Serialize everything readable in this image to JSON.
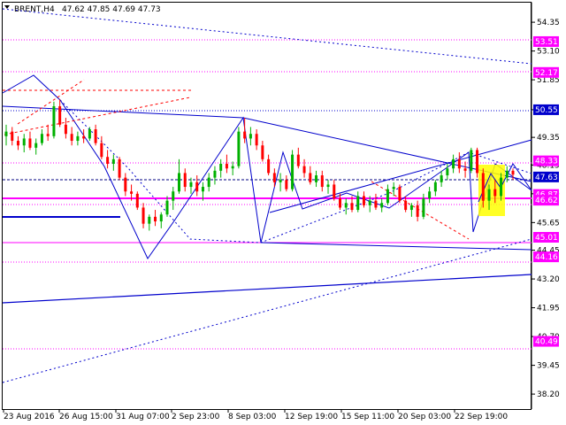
{
  "header": {
    "symbol_timeframe": "BRENT,H4",
    "ohlc": "47.62 47.85 47.69 47.73"
  },
  "chart_data": {
    "type": "candlestick",
    "title": "",
    "xlabel": "",
    "ylabel": "",
    "ylim": [
      37.55,
      55.2
    ],
    "grid": false,
    "y_ticks": [
      54.35,
      53.1,
      51.85,
      50.55,
      49.35,
      48.15,
      46.9,
      45.65,
      44.45,
      43.2,
      41.95,
      40.7,
      39.45,
      38.2
    ],
    "x_ticks": [
      "23 Aug 2016",
      "26 Aug 15:00",
      "31 Aug 07:00",
      "2 Sep 23:00",
      "8 Sep 03:00",
      "12 Sep 19:00",
      "15 Sep 11:00",
      "20 Sep 03:00",
      "22 Sep 19:00"
    ],
    "price_tags": [
      {
        "value": 53.51,
        "label": "53.51",
        "color": "#ff00ff"
      },
      {
        "value": 52.17,
        "label": "52.17",
        "color": "#ff00ff"
      },
      {
        "value": 50.55,
        "label": "50.55",
        "color": "#0000cc"
      },
      {
        "value": 48.33,
        "label": "48.33",
        "color": "#ff00ff"
      },
      {
        "value": 47.63,
        "label": "47.63",
        "color": "#0000cc"
      },
      {
        "value": 46.87,
        "label": "46.87",
        "color": "#ff00ff"
      },
      {
        "value": 46.62,
        "label": "46.62",
        "color": "#ff00ff"
      },
      {
        "value": 45.01,
        "label": "45.01",
        "color": "#ff00ff"
      },
      {
        "value": 44.16,
        "label": "44.16",
        "color": "#ff00ff"
      },
      {
        "value": 40.49,
        "label": "40.49",
        "color": "#ff00ff"
      }
    ],
    "series": [
      {
        "values": [
          {
            "o": 49.4,
            "h": 49.9,
            "l": 49.0,
            "c": 49.6
          },
          {
            "o": 49.6,
            "h": 49.8,
            "l": 49.0,
            "c": 49.2
          },
          {
            "o": 49.2,
            "h": 49.4,
            "l": 48.8,
            "c": 49.0
          },
          {
            "o": 49.0,
            "h": 49.5,
            "l": 48.7,
            "c": 49.3
          },
          {
            "o": 49.3,
            "h": 49.6,
            "l": 48.8,
            "c": 48.9
          },
          {
            "o": 48.9,
            "h": 49.3,
            "l": 48.6,
            "c": 49.1
          },
          {
            "o": 49.1,
            "h": 49.7,
            "l": 49.0,
            "c": 49.5
          },
          {
            "o": 49.5,
            "h": 49.9,
            "l": 49.2,
            "c": 49.4
          },
          {
            "o": 49.4,
            "h": 50.9,
            "l": 49.3,
            "c": 50.7
          },
          {
            "o": 50.7,
            "h": 51.0,
            "l": 49.8,
            "c": 49.9
          },
          {
            "o": 49.9,
            "h": 50.2,
            "l": 49.3,
            "c": 49.5
          },
          {
            "o": 49.5,
            "h": 49.8,
            "l": 49.0,
            "c": 49.2
          },
          {
            "o": 49.2,
            "h": 49.6,
            "l": 49.0,
            "c": 49.4
          },
          {
            "o": 49.4,
            "h": 49.7,
            "l": 49.1,
            "c": 49.3
          },
          {
            "o": 49.3,
            "h": 49.8,
            "l": 49.2,
            "c": 49.7
          },
          {
            "o": 49.7,
            "h": 49.9,
            "l": 49.0,
            "c": 49.1
          },
          {
            "o": 49.1,
            "h": 49.4,
            "l": 48.4,
            "c": 48.5
          },
          {
            "o": 48.5,
            "h": 48.8,
            "l": 48.0,
            "c": 48.2
          },
          {
            "o": 48.2,
            "h": 48.6,
            "l": 47.9,
            "c": 48.4
          },
          {
            "o": 48.4,
            "h": 48.5,
            "l": 47.5,
            "c": 47.6
          },
          {
            "o": 47.6,
            "h": 47.8,
            "l": 46.8,
            "c": 47.0
          },
          {
            "o": 47.0,
            "h": 47.3,
            "l": 46.6,
            "c": 46.9
          },
          {
            "o": 46.9,
            "h": 47.0,
            "l": 46.2,
            "c": 46.3
          },
          {
            "o": 46.3,
            "h": 46.5,
            "l": 45.4,
            "c": 45.6
          },
          {
            "o": 45.6,
            "h": 46.0,
            "l": 45.3,
            "c": 45.9
          },
          {
            "o": 45.9,
            "h": 46.2,
            "l": 45.5,
            "c": 45.7
          },
          {
            "o": 45.7,
            "h": 46.1,
            "l": 45.4,
            "c": 46.0
          },
          {
            "o": 46.0,
            "h": 46.8,
            "l": 45.9,
            "c": 46.6
          },
          {
            "o": 46.6,
            "h": 47.2,
            "l": 46.2,
            "c": 47.0
          },
          {
            "o": 47.0,
            "h": 48.4,
            "l": 46.9,
            "c": 47.8
          },
          {
            "o": 47.8,
            "h": 48.0,
            "l": 47.0,
            "c": 47.2
          },
          {
            "o": 47.2,
            "h": 47.6,
            "l": 46.9,
            "c": 47.4
          },
          {
            "o": 47.4,
            "h": 47.7,
            "l": 46.8,
            "c": 47.0
          },
          {
            "o": 47.0,
            "h": 47.4,
            "l": 46.6,
            "c": 47.2
          },
          {
            "o": 47.2,
            "h": 47.8,
            "l": 47.0,
            "c": 47.6
          },
          {
            "o": 47.6,
            "h": 48.1,
            "l": 47.3,
            "c": 47.9
          },
          {
            "o": 47.9,
            "h": 48.4,
            "l": 47.6,
            "c": 48.2
          },
          {
            "o": 48.2,
            "h": 48.6,
            "l": 47.8,
            "c": 48.0
          },
          {
            "o": 48.0,
            "h": 48.3,
            "l": 47.7,
            "c": 48.1
          },
          {
            "o": 48.1,
            "h": 49.8,
            "l": 48.0,
            "c": 49.6
          },
          {
            "o": 49.6,
            "h": 50.2,
            "l": 49.1,
            "c": 49.3
          },
          {
            "o": 49.3,
            "h": 49.8,
            "l": 49.0,
            "c": 49.5
          },
          {
            "o": 49.5,
            "h": 49.7,
            "l": 48.8,
            "c": 49.0
          },
          {
            "o": 49.0,
            "h": 49.2,
            "l": 48.3,
            "c": 48.4
          },
          {
            "o": 48.4,
            "h": 48.6,
            "l": 47.7,
            "c": 47.8
          },
          {
            "o": 47.8,
            "h": 48.0,
            "l": 47.2,
            "c": 47.4
          },
          {
            "o": 47.4,
            "h": 47.8,
            "l": 47.0,
            "c": 47.5
          },
          {
            "o": 47.5,
            "h": 47.7,
            "l": 47.0,
            "c": 47.1
          },
          {
            "o": 47.1,
            "h": 48.8,
            "l": 47.0,
            "c": 48.6
          },
          {
            "o": 48.6,
            "h": 48.9,
            "l": 48.0,
            "c": 48.1
          },
          {
            "o": 48.1,
            "h": 48.4,
            "l": 47.6,
            "c": 47.8
          },
          {
            "o": 47.8,
            "h": 48.1,
            "l": 47.3,
            "c": 47.4
          },
          {
            "o": 47.4,
            "h": 47.9,
            "l": 47.2,
            "c": 47.7
          },
          {
            "o": 47.7,
            "h": 47.9,
            "l": 47.0,
            "c": 47.2
          },
          {
            "o": 47.2,
            "h": 47.5,
            "l": 46.9,
            "c": 47.3
          },
          {
            "o": 47.3,
            "h": 47.5,
            "l": 46.6,
            "c": 46.7
          },
          {
            "o": 46.7,
            "h": 46.9,
            "l": 46.2,
            "c": 46.3
          },
          {
            "o": 46.3,
            "h": 46.7,
            "l": 46.0,
            "c": 46.5
          },
          {
            "o": 46.5,
            "h": 46.8,
            "l": 46.1,
            "c": 46.2
          },
          {
            "o": 46.2,
            "h": 47.0,
            "l": 46.1,
            "c": 46.8
          },
          {
            "o": 46.8,
            "h": 47.0,
            "l": 46.3,
            "c": 46.4
          },
          {
            "o": 46.4,
            "h": 46.8,
            "l": 46.1,
            "c": 46.6
          },
          {
            "o": 46.6,
            "h": 46.9,
            "l": 46.2,
            "c": 46.3
          },
          {
            "o": 46.3,
            "h": 46.7,
            "l": 46.1,
            "c": 46.5
          },
          {
            "o": 46.5,
            "h": 47.3,
            "l": 46.4,
            "c": 47.1
          },
          {
            "o": 47.1,
            "h": 47.4,
            "l": 46.8,
            "c": 47.2
          },
          {
            "o": 47.2,
            "h": 47.3,
            "l": 46.5,
            "c": 46.6
          },
          {
            "o": 46.6,
            "h": 46.8,
            "l": 46.1,
            "c": 46.2
          },
          {
            "o": 46.2,
            "h": 46.5,
            "l": 45.9,
            "c": 46.4
          },
          {
            "o": 46.4,
            "h": 46.6,
            "l": 45.7,
            "c": 45.9
          },
          {
            "o": 45.9,
            "h": 46.9,
            "l": 45.8,
            "c": 46.7
          },
          {
            "o": 46.7,
            "h": 47.2,
            "l": 46.5,
            "c": 47.0
          },
          {
            "o": 47.0,
            "h": 47.5,
            "l": 46.8,
            "c": 47.4
          },
          {
            "o": 47.4,
            "h": 47.9,
            "l": 47.2,
            "c": 47.7
          },
          {
            "o": 47.7,
            "h": 48.2,
            "l": 47.5,
            "c": 48.0
          },
          {
            "o": 48.0,
            "h": 48.6,
            "l": 47.8,
            "c": 48.4
          },
          {
            "o": 48.4,
            "h": 48.7,
            "l": 47.8,
            "c": 48.0
          },
          {
            "o": 48.0,
            "h": 48.3,
            "l": 47.6,
            "c": 47.9
          },
          {
            "o": 47.9,
            "h": 48.9,
            "l": 47.8,
            "c": 48.8
          },
          {
            "o": 48.8,
            "h": 48.9,
            "l": 47.6,
            "c": 47.8
          },
          {
            "o": 47.8,
            "h": 48.0,
            "l": 46.3,
            "c": 46.6
          },
          {
            "o": 46.6,
            "h": 47.3,
            "l": 46.2,
            "c": 47.1
          },
          {
            "o": 47.1,
            "h": 47.5,
            "l": 46.5,
            "c": 46.8
          },
          {
            "o": 46.8,
            "h": 47.8,
            "l": 46.6,
            "c": 47.6
          },
          {
            "o": 47.6,
            "h": 48.1,
            "l": 47.4,
            "c": 47.9
          },
          {
            "o": 47.9,
            "h": 48.0,
            "l": 47.5,
            "c": 47.73
          }
        ]
      }
    ]
  }
}
